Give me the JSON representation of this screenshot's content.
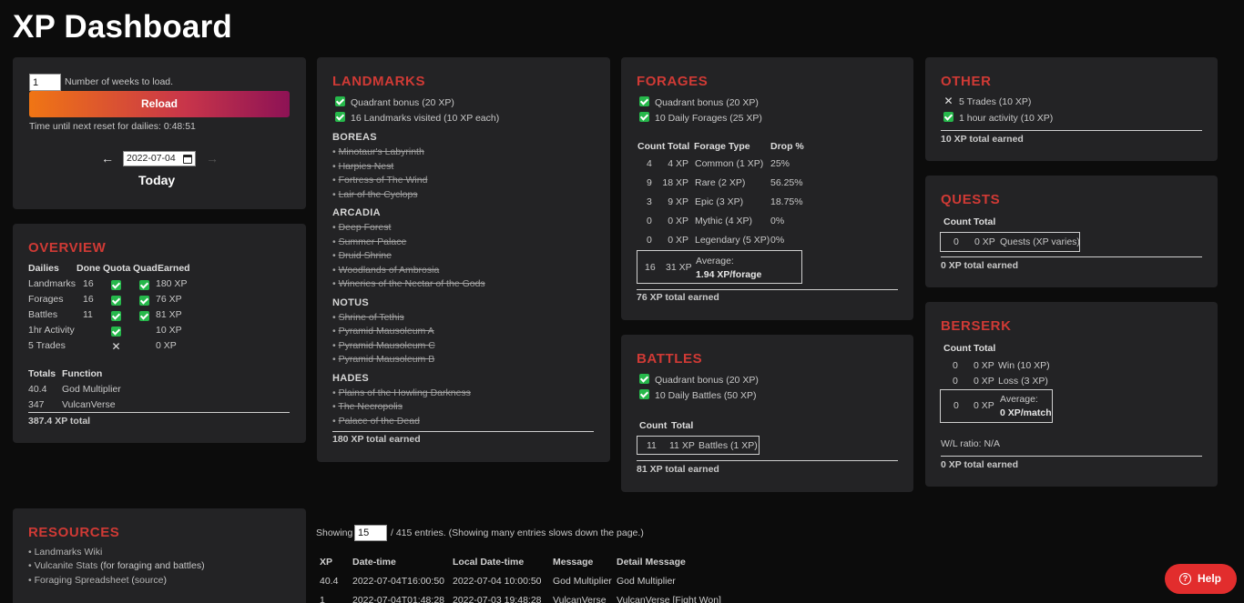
{
  "title": "XP Dashboard",
  "controls": {
    "weeks_value": "1",
    "weeks_label": "Number of weeks to load.",
    "reload": "Reload",
    "reset_text": "Time until next reset for dailies: 0:48:51",
    "prev_arrow": "←",
    "next_arrow": "→",
    "date_value": "2022-07-04",
    "day_label": "Today"
  },
  "overview": {
    "title": "OVERVIEW",
    "headers": [
      "Dailies",
      "Done",
      "Quota",
      "Quad",
      "Earned"
    ],
    "rows": [
      {
        "name": "Landmarks",
        "done": "16",
        "quota": "check",
        "quad": "check",
        "earned": "180 XP"
      },
      {
        "name": "Forages",
        "done": "16",
        "quota": "check",
        "quad": "check",
        "earned": "76 XP"
      },
      {
        "name": "Battles",
        "done": "11",
        "quota": "check",
        "quad": "check",
        "earned": "81 XP"
      },
      {
        "name": "1hr Activity",
        "done": "",
        "quota": "check",
        "quad": "",
        "earned": "10 XP"
      },
      {
        "name": "5 Trades",
        "done": "",
        "quota": "x",
        "quad": "",
        "earned": "0 XP"
      }
    ],
    "totals_headers": [
      "Totals",
      "Function"
    ],
    "totals": [
      {
        "value": "40.4",
        "fn": "God Multiplier"
      },
      {
        "value": "347",
        "fn": "VulcanVerse"
      }
    ],
    "grand_total": "387.4 XP total"
  },
  "landmarks": {
    "title": "LANDMARKS",
    "bonuses": [
      "Quadrant bonus (20 XP)",
      "16 Landmarks visited (10 XP each)"
    ],
    "regions": [
      {
        "name": "BOREAS",
        "items": [
          "Minotaur's Labyrinth",
          "Harpies Nest",
          "Fortress of The Wind",
          "Lair of the Cyclops"
        ]
      },
      {
        "name": "ARCADIA",
        "items": [
          "Deep Forest",
          "Summer Palace",
          "Druid Shrine",
          "Woodlands of Ambrosia",
          "Wineries of the Nectar of the Gods"
        ]
      },
      {
        "name": "NOTUS",
        "items": [
          "Shrine of Tethis",
          "Pyramid Mausoleum A",
          "Pyramid Mausoleum C",
          "Pyramid Mausoleum B"
        ]
      },
      {
        "name": "HADES",
        "items": [
          "Plains of the Howling Darkness",
          "The Necropolis",
          "Palace of the Dead"
        ]
      }
    ],
    "total": "180 XP total earned"
  },
  "forages": {
    "title": "FORAGES",
    "bonuses": [
      "Quadrant bonus (20 XP)",
      "10 Daily Forages (25 XP)"
    ],
    "headers": [
      "Count",
      "Total",
      "Forage Type",
      "Drop %"
    ],
    "rows": [
      {
        "count": "4",
        "total": "4 XP",
        "type": "Common (1 XP)",
        "drop": "25%"
      },
      {
        "count": "9",
        "total": "18 XP",
        "type": "Rare (2 XP)",
        "drop": "56.25%"
      },
      {
        "count": "3",
        "total": "9 XP",
        "type": "Epic (3 XP)",
        "drop": "18.75%"
      },
      {
        "count": "0",
        "total": "0 XP",
        "type": "Mythic (4 XP)",
        "drop": "0%"
      },
      {
        "count": "0",
        "total": "0 XP",
        "type": "Legendary (5 XP)",
        "drop": "0%"
      }
    ],
    "sum_count": "16",
    "sum_total": "31 XP",
    "avg_label": "Average:",
    "avg_value": "1.94 XP/forage",
    "total": "76 XP total earned"
  },
  "battles": {
    "title": "BATTLES",
    "bonuses": [
      "Quadrant bonus (20 XP)",
      "10 Daily Battles (50 XP)"
    ],
    "headers": [
      "Count",
      "Total"
    ],
    "count": "11",
    "sum": "11 XP",
    "label": "Battles (1 XP)",
    "total": "81 XP total earned"
  },
  "other": {
    "title": "OTHER",
    "items": [
      {
        "label": "5 Trades (10 XP)",
        "state": "x"
      },
      {
        "label": "1 hour activity (10 XP)",
        "state": "check"
      }
    ],
    "total": "10 XP total earned"
  },
  "quests": {
    "title": "QUESTS",
    "headers": [
      "Count",
      "Total"
    ],
    "count": "0",
    "sum": "0 XP",
    "label": "Quests (XP varies)",
    "total": "0 XP total earned"
  },
  "berserk": {
    "title": "BERSERK",
    "headers": [
      "Count",
      "Total"
    ],
    "rows": [
      {
        "count": "0",
        "total": "0 XP",
        "label": "Win (10 XP)"
      },
      {
        "count": "0",
        "total": "0 XP",
        "label": "Loss (3 XP)"
      }
    ],
    "sum_count": "0",
    "sum_total": "0 XP",
    "avg_label": "Average:",
    "avg_value": "0 XP/match",
    "wl": "W/L ratio: N/A",
    "total": "0 XP total earned"
  },
  "resources": {
    "title": "RESOURCES",
    "links": [
      {
        "prefix": "• ",
        "link": "Landmarks Wiki",
        "suffix": ""
      },
      {
        "prefix": "• ",
        "link": "Vulcanite Stats",
        "suffix": " (for foraging and battles)"
      },
      {
        "prefix": "• ",
        "link": "Foraging Spreadsheet",
        "suffix": " (",
        "link2": "source",
        "suffix2": ")"
      }
    ]
  },
  "log": {
    "showing": "Showing",
    "entries_value": "15",
    "entries_text": "/ 415 entries. (Showing many entries slows down the page.)",
    "headers": [
      "XP",
      "Date-time",
      "Local Date-time",
      "Message",
      "Detail Message"
    ],
    "rows": [
      [
        "40.4",
        "2022-07-04T16:00:50",
        "2022-07-04 10:00:50",
        "God Multiplier",
        "God Multiplier"
      ],
      [
        "1",
        "2022-07-04T01:48:28",
        "2022-07-03 19:48:28",
        "VulcanVerse",
        "VulcanVerse [Fight Won]"
      ]
    ]
  },
  "help": {
    "label": "Help",
    "icon": "?"
  },
  "colors": {
    "accent": "#d03a35",
    "check": "#26b84b",
    "card": "#232325",
    "background": "#0c0c0c"
  }
}
